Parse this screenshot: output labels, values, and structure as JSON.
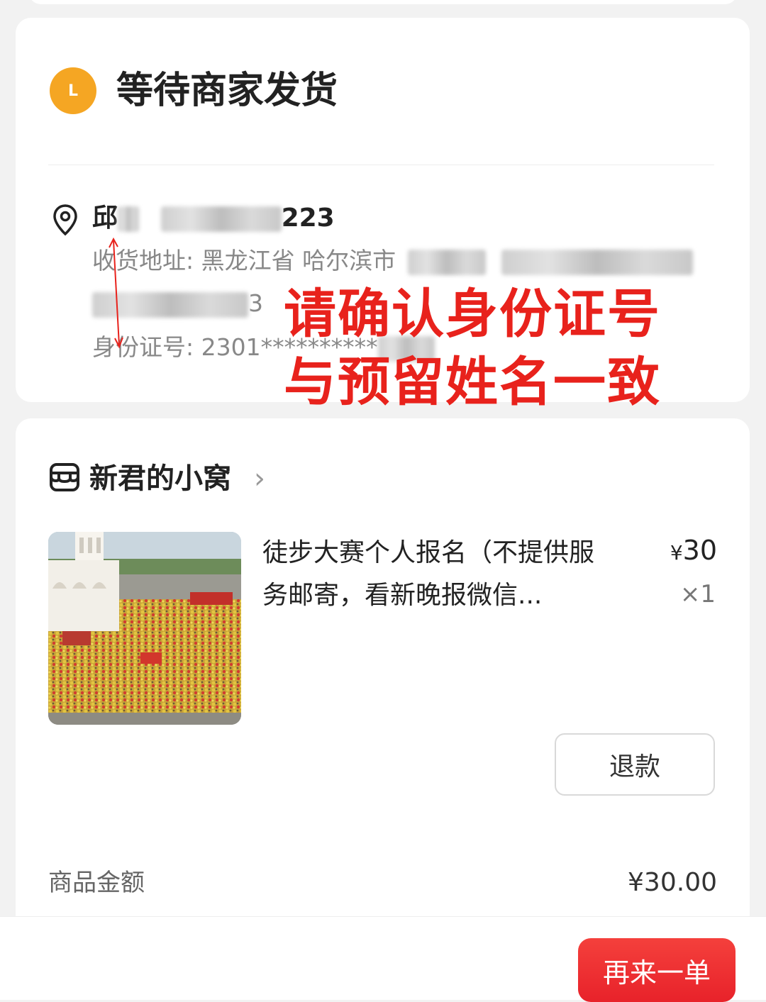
{
  "status": {
    "icon_letter": "L",
    "title": "等待商家发货"
  },
  "recipient": {
    "name_visible": "邱",
    "phone_suffix": "223",
    "address_label": "收货地址: 黑龙江省 哈尔滨市",
    "address_tail": "3",
    "id_label": "身份证号: 2301**********"
  },
  "annotation": {
    "line1": "请确认身份证号",
    "line2": "与预留姓名一致",
    "color": "#e8221c"
  },
  "shop": {
    "name": "新君的小窝",
    "chevron": "›"
  },
  "product": {
    "title": "徒步大赛个人报名（不提供服务邮寄，看新晚报微信...",
    "currency": "¥",
    "price": "30",
    "quantity": "×1"
  },
  "actions": {
    "refund_label": "退款",
    "reorder_label": "再来一单"
  },
  "summary": {
    "amount_label": "商品金额",
    "amount_value": "¥30.00"
  },
  "colors": {
    "status_icon": "#f5a623",
    "primary_button": "#e8222a"
  }
}
